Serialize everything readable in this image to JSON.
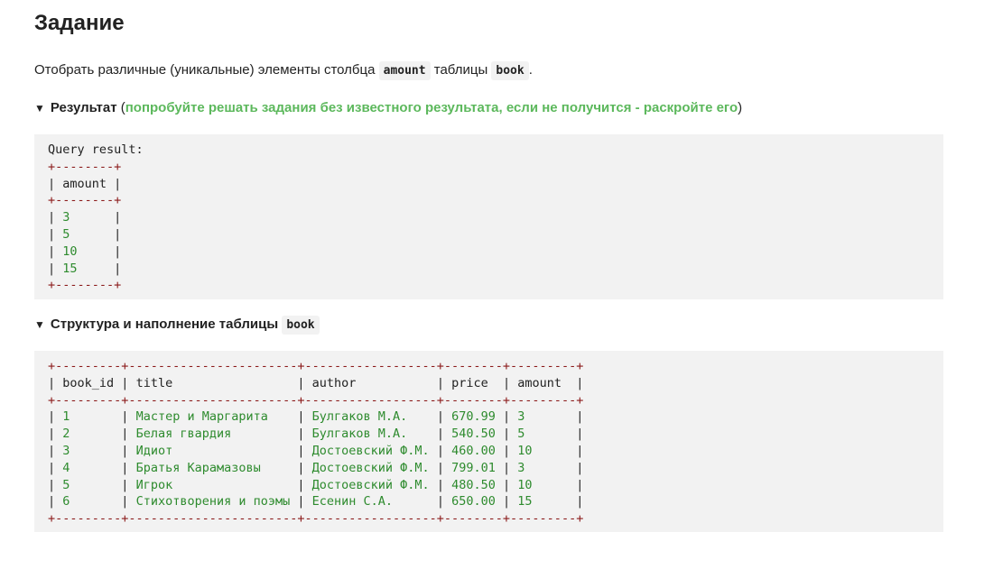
{
  "title": "Задание",
  "task": {
    "text_before": "Отобрать различные (уникальные) элементы столбца ",
    "code1": "amount",
    "text_middle": " таблицы ",
    "code2": "book",
    "text_after": "."
  },
  "result_section": {
    "label": "Результат",
    "open_paren": "(",
    "hint": "попробуйте решать задания без известного результата, если не получится - раскройте его",
    "close_paren": ")",
    "query_header": "Query result:",
    "column": "amount",
    "values": [
      "3",
      "5",
      "10",
      "15"
    ]
  },
  "structure_section": {
    "label": "Структура и наполнение таблицы",
    "table_name": "book",
    "columns": [
      "book_id",
      "title",
      "author",
      "price",
      "amount"
    ],
    "rows": [
      [
        "1",
        "Мастер и Маргарита",
        "Булгаков М.А.",
        "670.99",
        "3"
      ],
      [
        "2",
        "Белая гвардия",
        "Булгаков М.А.",
        "540.50",
        "5"
      ],
      [
        "3",
        "Идиот",
        "Достоевский Ф.М.",
        "460.00",
        "10"
      ],
      [
        "4",
        "Братья Карамазовы",
        "Достоевский Ф.М.",
        "799.01",
        "3"
      ],
      [
        "5",
        "Игрок",
        "Достоевский Ф.М.",
        "480.50",
        "10"
      ],
      [
        "6",
        "Стихотворения и поэмы",
        "Есенин С.А.",
        "650.00",
        "15"
      ]
    ]
  },
  "colors": {
    "hint_green": "#5cb85c",
    "border_red": "#8b1a1a",
    "value_green": "#2e8b2e",
    "block_bg": "#f2f2f2"
  }
}
